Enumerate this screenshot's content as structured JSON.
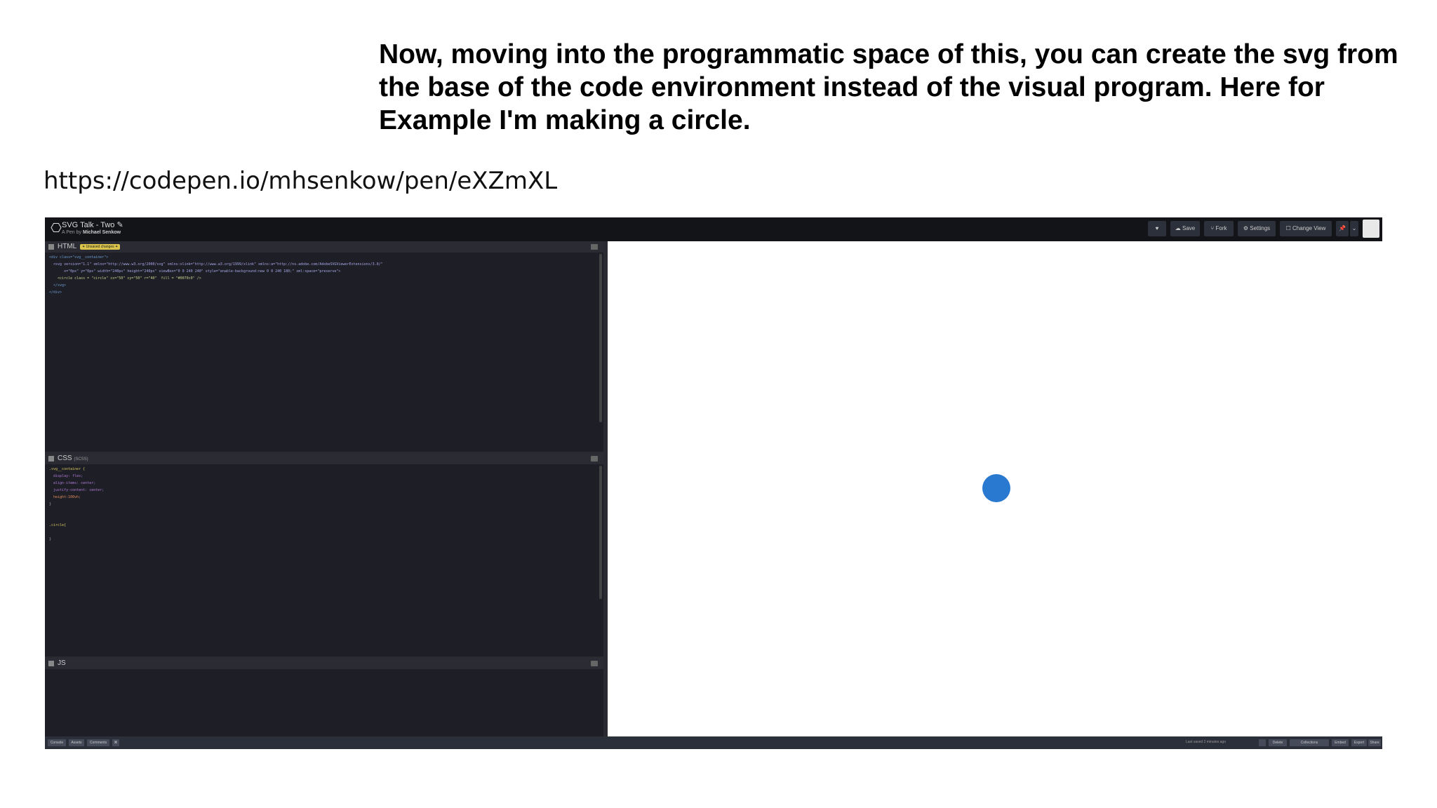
{
  "slide": {
    "caption": "Now, moving into the programmatic space of this, you can create the svg from the base of the code environment instead of the visual program. Here for Example I'm making a circle.",
    "url": "https://codepen.io/mhsenkow/pen/eXZmXL"
  },
  "codepen": {
    "logo_icon": "codepen-logo-icon",
    "pen_title": "SVG Talk - Two",
    "edit_icon": "✎",
    "pen_by": "A Pen by",
    "author": "Michael Senkow",
    "toolbar": {
      "heart_icon": "♥",
      "save_label": "☁ Save",
      "fork_label": "⑂ Fork",
      "settings_label": "⚙ Settings",
      "change_view_label": "☐ Change View",
      "pin_icon": "📌",
      "more_icon": "⌄"
    },
    "html_pane": {
      "name": "HTML",
      "badge": "✦ Unsaved changes ✦",
      "lines": [
        "<div class=\"svg__container\">",
        "  <svg version=\"1.1\" xmlns=\"http://www.w3.org/2000/svg\" xmlns:xlink=\"http://www.w3.org/1999/xlink\" xmlns:a=\"http://ns.adobe.com/AdobeSVGViewerExtensions/3.0/\"",
        "       x=\"0px\" y=\"0px\" width=\"240px\" height=\"240px\" viewBox=\"0 0 240 240\" style=\"enable-background:new 0 0 240 180;\" xml:space=\"preserve\">",
        "    <circle class = \"circle\" cx=\"50\" cy=\"50\" r=\"40\"  fill = \"#0070c0\" />",
        "  </svg>",
        "</div>"
      ]
    },
    "css_pane": {
      "name": "CSS",
      "tag": "(SCSS)",
      "lines": [
        ".svg__container {",
        "  display: flex;",
        "  align-items: center;",
        "  justify-content: center;",
        "  height:100vh;",
        "}",
        "",
        "",
        ".circle{",
        "",
        "}"
      ]
    },
    "js_pane": {
      "name": "JS"
    },
    "preview": {
      "circle_color": "#2a79d0"
    },
    "footer": {
      "console_label": "Console",
      "assets_label": "Assets",
      "comments_label": "Comments",
      "shortcut_label": "⌘",
      "last_saved": "Last saved 2 minutes ago",
      "delete_label": "Delete",
      "collections_label": "Collections",
      "embed_label": "Embed",
      "export_label": "Export",
      "share_label": "Share"
    }
  }
}
